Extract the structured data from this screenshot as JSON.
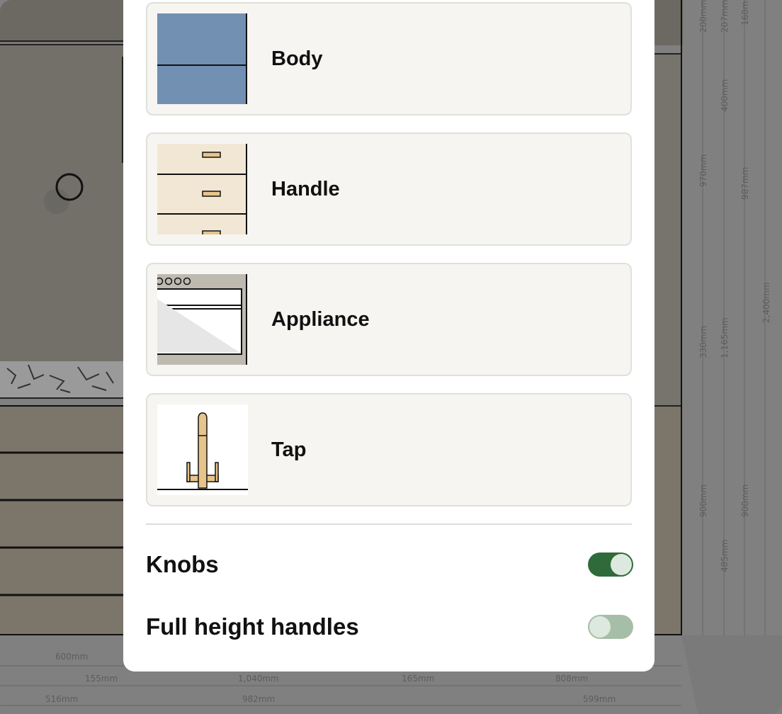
{
  "options": [
    {
      "id": "body",
      "label": "Body",
      "thumbnail": "body-color-swatch-icon",
      "color": "#7190b2"
    },
    {
      "id": "handle",
      "label": "Handle",
      "thumbnail": "drawer-handles-icon",
      "color": "#f1e7d4"
    },
    {
      "id": "appliance",
      "label": "Appliance",
      "thumbnail": "oven-appliance-icon"
    },
    {
      "id": "tap",
      "label": "Tap",
      "thumbnail": "kitchen-tap-icon",
      "color": "#e6c48a"
    }
  ],
  "toggles": [
    {
      "id": "knobs",
      "label": "Knobs",
      "on": true
    },
    {
      "id": "full-height-handles",
      "label": "Full height handles",
      "on": false
    }
  ],
  "colors": {
    "toggle_on": "#2f6b3a",
    "toggle_off": "#a6bea7"
  },
  "dimensions": {
    "vertical": [
      "200mm",
      "207mm",
      "160mm",
      "400mm",
      "970mm",
      "987mm",
      "2,400mm",
      "330mm",
      "1,165mm",
      "900mm",
      "900mm",
      "485mm"
    ],
    "horizontal": [
      "600mm",
      "155mm",
      "1,040mm",
      "165mm",
      "808mm",
      "516mm",
      "982mm",
      "599mm"
    ]
  }
}
